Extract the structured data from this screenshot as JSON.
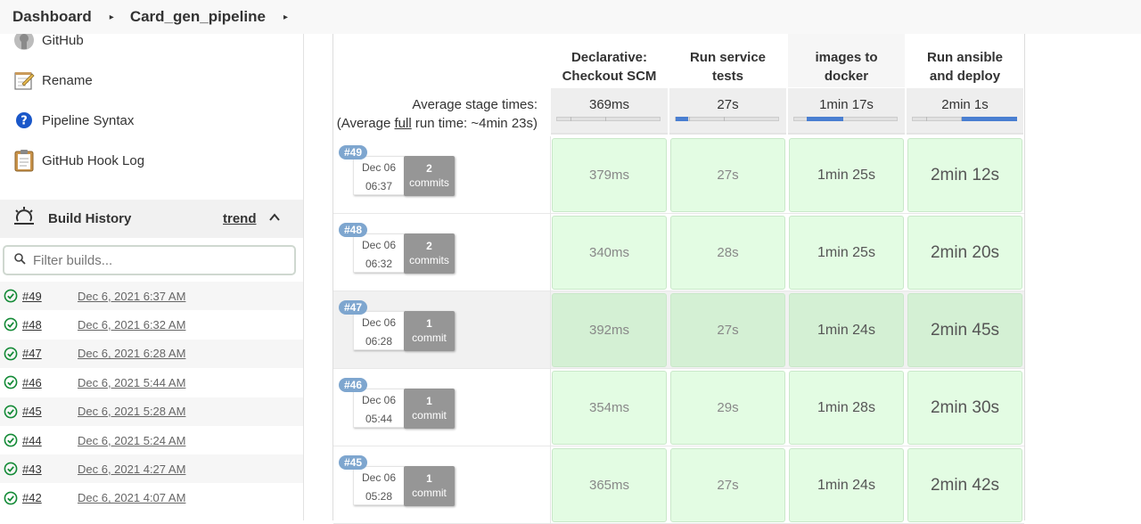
{
  "breadcrumb": {
    "items": [
      "Dashboard",
      "Card_gen_pipeline"
    ],
    "separator": "▸"
  },
  "sidebar": {
    "tasks": [
      {
        "label": "GitHub",
        "icon": "github-icon"
      },
      {
        "label": "Rename",
        "icon": "notepad-icon"
      },
      {
        "label": "Pipeline Syntax",
        "icon": "help-icon"
      },
      {
        "label": "GitHub Hook Log",
        "icon": "clipboard-icon"
      }
    ],
    "build_history": {
      "title": "Build History",
      "trend_label": "trend",
      "filter_placeholder": "Filter builds...",
      "builds": [
        {
          "number": "#49",
          "date": "Dec 6, 2021 6:37 AM"
        },
        {
          "number": "#48",
          "date": "Dec 6, 2021 6:32 AM"
        },
        {
          "number": "#47",
          "date": "Dec 6, 2021 6:28 AM"
        },
        {
          "number": "#46",
          "date": "Dec 6, 2021 5:44 AM"
        },
        {
          "number": "#45",
          "date": "Dec 6, 2021 5:28 AM"
        },
        {
          "number": "#44",
          "date": "Dec 6, 2021 5:24 AM"
        },
        {
          "number": "#43",
          "date": "Dec 6, 2021 4:27 AM"
        },
        {
          "number": "#42",
          "date": "Dec 6, 2021 4:07 AM"
        }
      ]
    }
  },
  "stage_view": {
    "stages": [
      {
        "lines": [
          "Declarative:",
          "Checkout SCM"
        ]
      },
      {
        "lines": [
          "Run service",
          "tests"
        ]
      },
      {
        "lines": [
          "",
          "images to",
          "docker"
        ]
      },
      {
        "lines": [
          "Run ansible",
          "and deploy"
        ]
      }
    ],
    "avg_label_line1": "Average stage times:",
    "avg_label_prefix": "(Average ",
    "avg_label_link": "full",
    "avg_label_suffix": " run time: ~4min 23s)",
    "averages": [
      {
        "value": "369ms",
        "share": 0.0
      },
      {
        "value": "27s",
        "share": 0.12
      },
      {
        "value": "1min 17s",
        "share": 0.35
      },
      {
        "value": "2min 1s",
        "share": 0.53
      }
    ],
    "builds": [
      {
        "badge": "#49",
        "date": "Dec 06",
        "time": "06:37",
        "commit_count": "2",
        "commit_word": "commits",
        "durations": [
          "379ms",
          "27s",
          "1min 25s",
          "2min 12s"
        ]
      },
      {
        "badge": "#48",
        "date": "Dec 06",
        "time": "06:32",
        "commit_count": "2",
        "commit_word": "commits",
        "durations": [
          "340ms",
          "28s",
          "1min 25s",
          "2min 20s"
        ]
      },
      {
        "badge": "#47",
        "date": "Dec 06",
        "time": "06:28",
        "commit_count": "1",
        "commit_word": "commit",
        "durations": [
          "392ms",
          "27s",
          "1min 24s",
          "2min 45s"
        ]
      },
      {
        "badge": "#46",
        "date": "Dec 06",
        "time": "05:44",
        "commit_count": "1",
        "commit_word": "commit",
        "durations": [
          "354ms",
          "29s",
          "1min 28s",
          "2min 30s"
        ]
      },
      {
        "badge": "#45",
        "date": "Dec 06",
        "time": "05:28",
        "commit_count": "1",
        "commit_word": "commit",
        "durations": [
          "365ms",
          "27s",
          "1min 24s",
          "2min 42s"
        ]
      }
    ]
  },
  "colors": {
    "success_green": "#138a36",
    "cell_bg": "#e3fce3",
    "badge_blue": "#7ea6cf",
    "progress_blue": "#4a7fd1"
  }
}
